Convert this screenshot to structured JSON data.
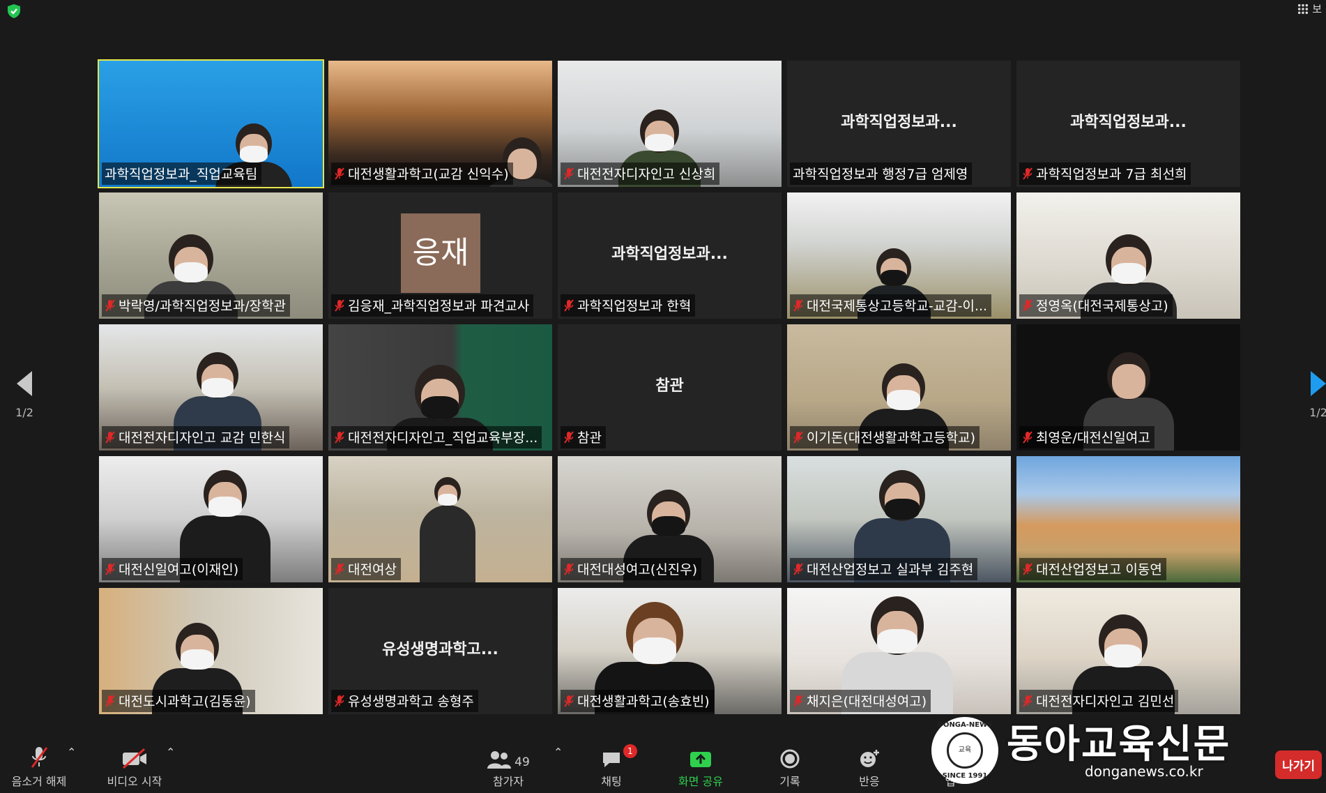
{
  "top": {
    "view_label": "보"
  },
  "nav": {
    "page_left": "1/2",
    "page_right": "1/2"
  },
  "tiles": [
    {
      "name": "과학직업정보과_직업교육팀",
      "active": true,
      "muted": false,
      "center": ""
    },
    {
      "name": "대전생활과학고(교감 신익수)",
      "muted": true,
      "center": ""
    },
    {
      "name": "대전전자디자인고 신상희",
      "muted": true,
      "center": ""
    },
    {
      "name": "과학직업정보과 행정7급 엄제영",
      "muted": false,
      "center": "과학직업정보과..."
    },
    {
      "name": "과학직업정보과 7급 최선희",
      "muted": true,
      "center": "과학직업정보과..."
    },
    {
      "name": "박락영/과학직업정보과/장학관",
      "muted": true,
      "center": ""
    },
    {
      "name": "김응재_과학직업정보과 파견교사",
      "muted": true,
      "center": "",
      "avatar": "응재"
    },
    {
      "name": "과학직업정보과 한혁",
      "muted": true,
      "center": "과학직업정보과..."
    },
    {
      "name": "대전국제통상고등학교-교감-이...",
      "muted": true,
      "center": ""
    },
    {
      "name": "정영옥(대전국제통상고)",
      "muted": true,
      "center": ""
    },
    {
      "name": "대전전자디자인고 교감 민한식",
      "muted": true,
      "center": ""
    },
    {
      "name": "대전전자디자인고_직업교육부장...",
      "muted": true,
      "center": ""
    },
    {
      "name": "참관",
      "muted": true,
      "center": "참관"
    },
    {
      "name": "이기돈(대전생활과학고등학교)",
      "muted": true,
      "center": ""
    },
    {
      "name": "최영운/대전신일여고",
      "muted": true,
      "center": ""
    },
    {
      "name": "대전신일여고(이재인)",
      "muted": true,
      "center": ""
    },
    {
      "name": "대전여상",
      "muted": true,
      "center": ""
    },
    {
      "name": "대전대성여고(신진우)",
      "muted": true,
      "center": ""
    },
    {
      "name": "대전산업정보고 실과부 김주현",
      "muted": true,
      "center": ""
    },
    {
      "name": "대전산업정보고 이동연",
      "muted": true,
      "center": ""
    },
    {
      "name": "대전도시과학고(김동윤)",
      "muted": true,
      "center": ""
    },
    {
      "name": "유성생명과학고 송형주",
      "muted": true,
      "center": "유성생명과학고..."
    },
    {
      "name": "대전생활과학고(송효빈)",
      "muted": true,
      "center": ""
    },
    {
      "name": "채지은(대전대성여고)",
      "muted": true,
      "center": ""
    },
    {
      "name": "대전전자디자인고 김민선",
      "muted": true,
      "center": ""
    }
  ],
  "toolbar": {
    "unmute": "음소거 해제",
    "start_video": "비디오 시작",
    "participants": "참가자",
    "participants_count": "49",
    "chat": "채팅",
    "chat_badge": "1",
    "share": "화면 공유",
    "record": "기록",
    "reactions": "반응",
    "apps": "앱",
    "leave": "나가기"
  },
  "watermark": {
    "brand": "동아교육신문",
    "url": "donganews.co.kr",
    "seal_top": "DONGA-NEWS",
    "seal_bottom": "SINCE 1991",
    "seal_center": "교육"
  },
  "colors": {
    "active_border": "#e6e64a",
    "share_green": "#2fd04e",
    "leave_red": "#d42b2b",
    "muted_red": "#e02828"
  }
}
